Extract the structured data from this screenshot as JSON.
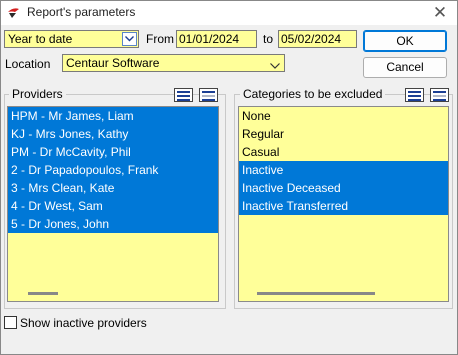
{
  "window": {
    "title": "Report's parameters",
    "icons": {
      "app": "report-app-icon",
      "close": "close-icon"
    }
  },
  "period": {
    "selected": "Year to date",
    "icon": "chevron-down-icon"
  },
  "dates": {
    "from_label": "From",
    "from_value": "01/01/2024",
    "to_label": "to",
    "to_value": "05/02/2024"
  },
  "location": {
    "label": "Location",
    "selected": "Centaur Software"
  },
  "buttons": {
    "ok": "OK",
    "cancel": "Cancel"
  },
  "providers": {
    "title": "Providers",
    "items": [
      {
        "label": "HPM - Mr James, Liam",
        "selected": true
      },
      {
        "label": "KJ - Mrs Jones, Kathy",
        "selected": true
      },
      {
        "label": "PM - Dr McCavity, Phil",
        "selected": true
      },
      {
        "label": "2 - Dr Papadopoulos, Frank",
        "selected": true
      },
      {
        "label": "3 - Mrs Clean, Kate",
        "selected": true
      },
      {
        "label": "4 - Dr West, Sam",
        "selected": true
      },
      {
        "label": "5 - Dr Jones, John",
        "selected": true
      }
    ]
  },
  "categories": {
    "title": "Categories to be excluded",
    "items": [
      {
        "label": "None",
        "selected": false
      },
      {
        "label": "Regular",
        "selected": false
      },
      {
        "label": "Casual",
        "selected": false
      },
      {
        "label": "Inactive",
        "selected": true
      },
      {
        "label": "Inactive Deceased",
        "selected": true
      },
      {
        "label": "Inactive Transferred",
        "selected": true
      }
    ]
  },
  "show_inactive": {
    "label": "Show inactive providers",
    "checked": false
  },
  "colors": {
    "field_bg": "#ffff99",
    "selection": "#0078d7",
    "window_bg": "#f0f0f0"
  }
}
